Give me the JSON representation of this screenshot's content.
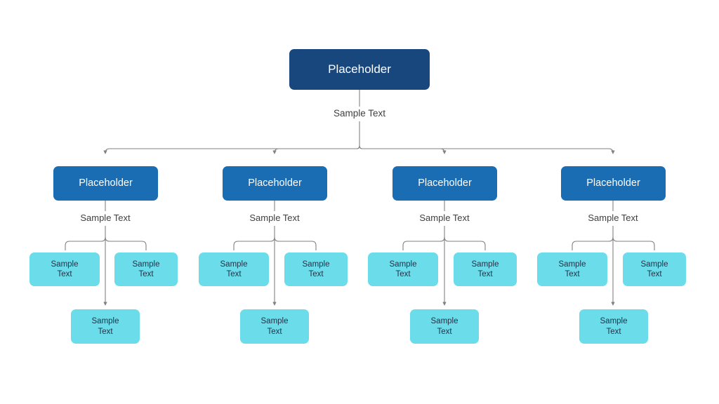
{
  "diagram": {
    "type": "organizational-hierarchy-tree",
    "background_color": "#ffffff",
    "levels": 3,
    "colors": {
      "root_fill": "#18477e",
      "branch_fill": "#1a6cb3",
      "leaf_fill": "#6bdce9",
      "connector_stroke": "#808080",
      "root_text": "#ffffff",
      "branch_text": "#ffffff",
      "leaf_text": "#20344a",
      "label_text": "#404040"
    },
    "root": {
      "label": "Placeholder",
      "edge_label": "Sample Text"
    },
    "branches": [
      {
        "label": "Placeholder",
        "edge_label": "Sample Text",
        "leaves": [
          {
            "line1": "Sample",
            "line2": "Text"
          },
          {
            "line1": "Sample",
            "line2": "Text"
          },
          {
            "line1": "Sample",
            "line2": "Text"
          }
        ]
      },
      {
        "label": "Placeholder",
        "edge_label": "Sample Text",
        "leaves": [
          {
            "line1": "Sample",
            "line2": "Text"
          },
          {
            "line1": "Sample",
            "line2": "Text"
          },
          {
            "line1": "Sample",
            "line2": "Text"
          }
        ]
      },
      {
        "label": "Placeholder",
        "edge_label": "Sample Text",
        "leaves": [
          {
            "line1": "Sample",
            "line2": "Text"
          },
          {
            "line1": "Sample",
            "line2": "Text"
          },
          {
            "line1": "Sample",
            "line2": "Text"
          }
        ]
      },
      {
        "label": "Placeholder",
        "edge_label": "Sample Text",
        "leaves": [
          {
            "line1": "Sample",
            "line2": "Text"
          },
          {
            "line1": "Sample",
            "line2": "Text"
          },
          {
            "line1": "Sample",
            "line2": "Text"
          }
        ]
      }
    ]
  }
}
